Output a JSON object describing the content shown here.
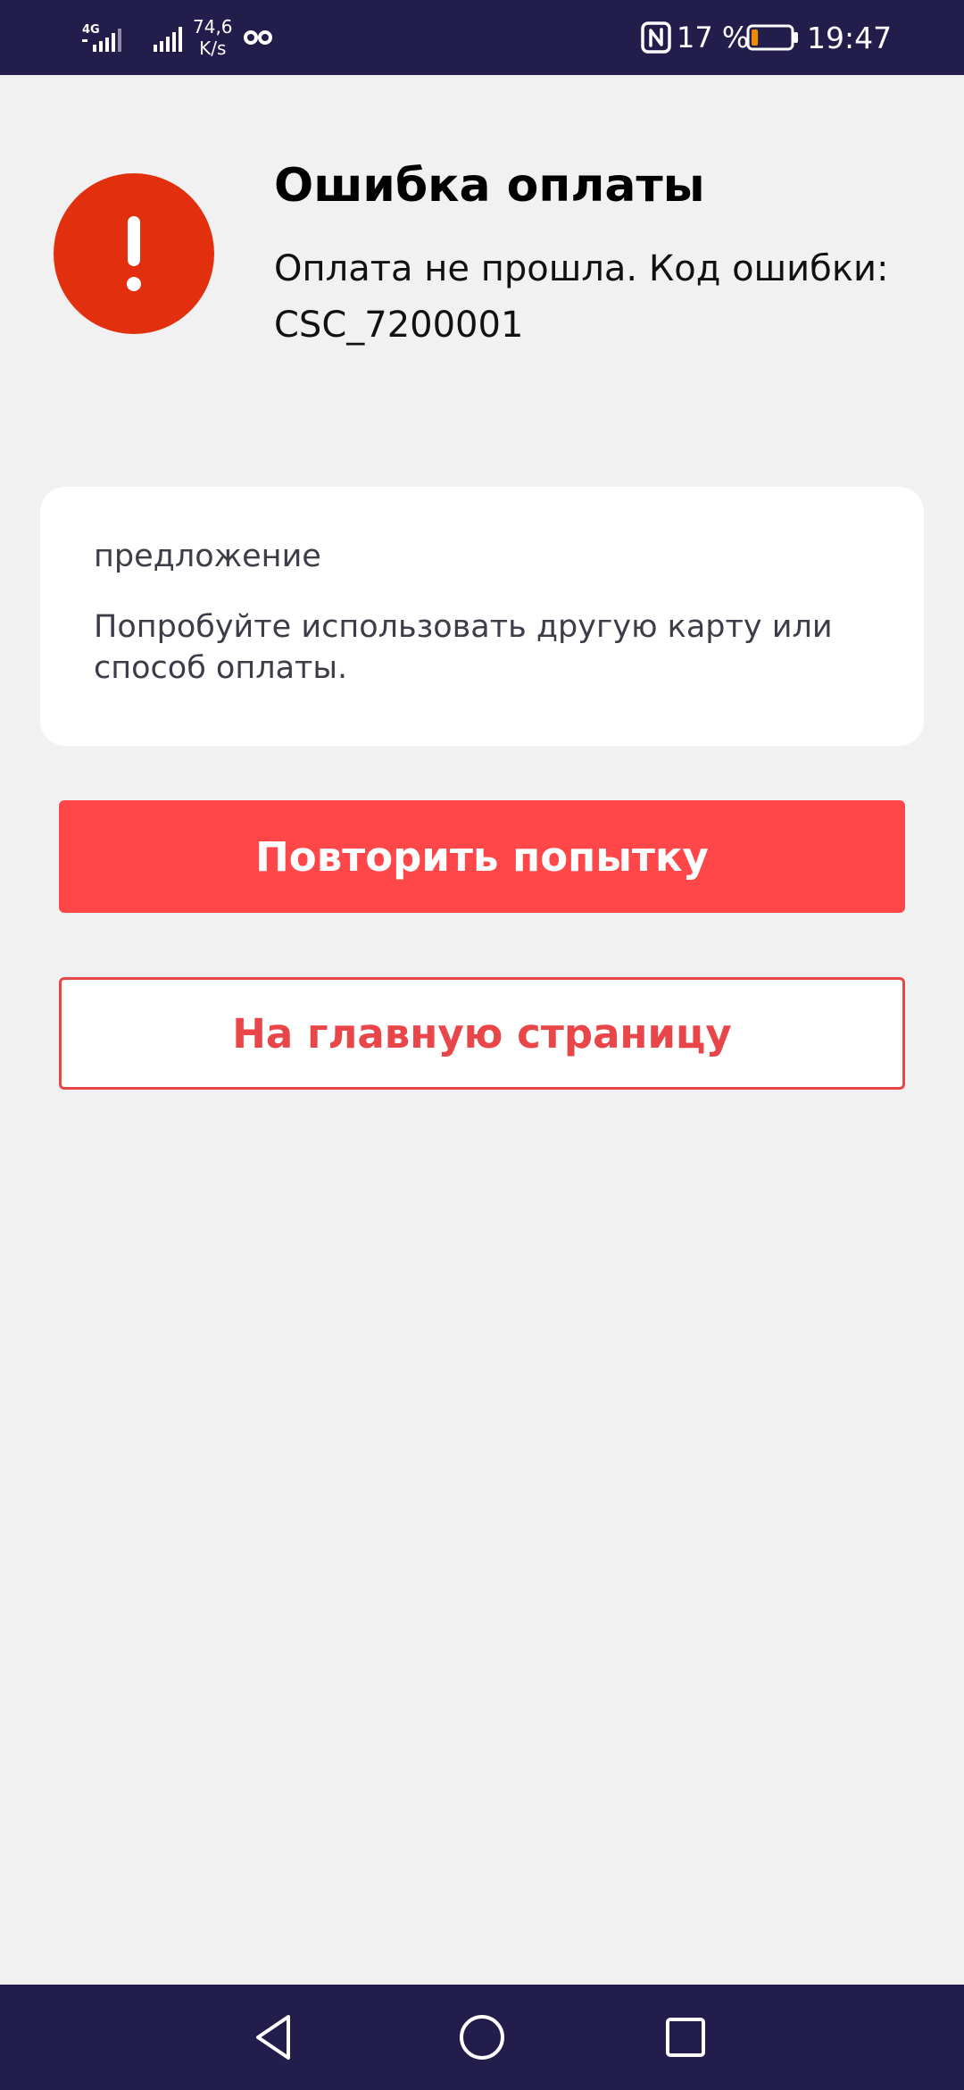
{
  "status_bar": {
    "network_type": "4G",
    "net_speed_value": "74,6",
    "net_speed_unit": "K/s",
    "battery_percent": "17 %",
    "battery_level": 0.17,
    "time": "19:47",
    "icons": [
      "signal-icon",
      "signal-icon",
      "vpn-icon",
      "nfc-icon",
      "battery-icon"
    ]
  },
  "error": {
    "icon": "exclamation-icon",
    "title": "Ошибка оплаты",
    "message": "Оплата не прошла. Код ошибки: CSC_7200001"
  },
  "suggestion": {
    "heading": "предложение",
    "text": "Попробуйте использовать другую карту или способ оплаты."
  },
  "actions": {
    "retry_label": "Повторить попытку",
    "home_label": "На главную страницу"
  },
  "nav_bar": {
    "buttons": [
      "back-icon",
      "home-icon",
      "recents-icon"
    ]
  },
  "colors": {
    "status_bar_bg": "#231d4b",
    "page_bg": "#f2f1f2",
    "error_badge": "#e2300f",
    "primary_button": "#ff474a",
    "secondary_button_border": "#e9464a",
    "battery_fill": "#f08a00"
  }
}
